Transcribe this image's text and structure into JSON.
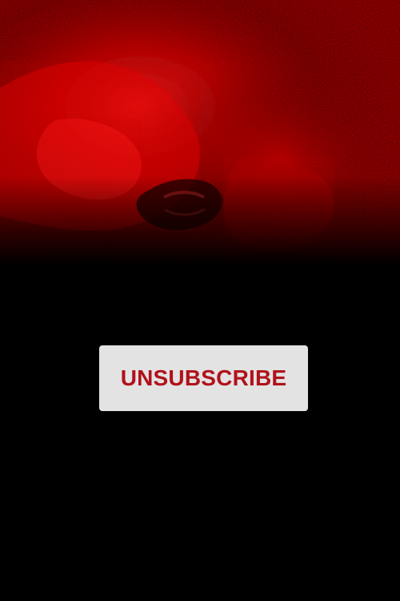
{
  "hero": {
    "image": "red-tinted-face-photo"
  },
  "cta": {
    "label": "UNSUBSCRIBE"
  },
  "colors": {
    "background": "#000000",
    "accent": "#B0121B",
    "button_bg": "#E3E3E3"
  }
}
